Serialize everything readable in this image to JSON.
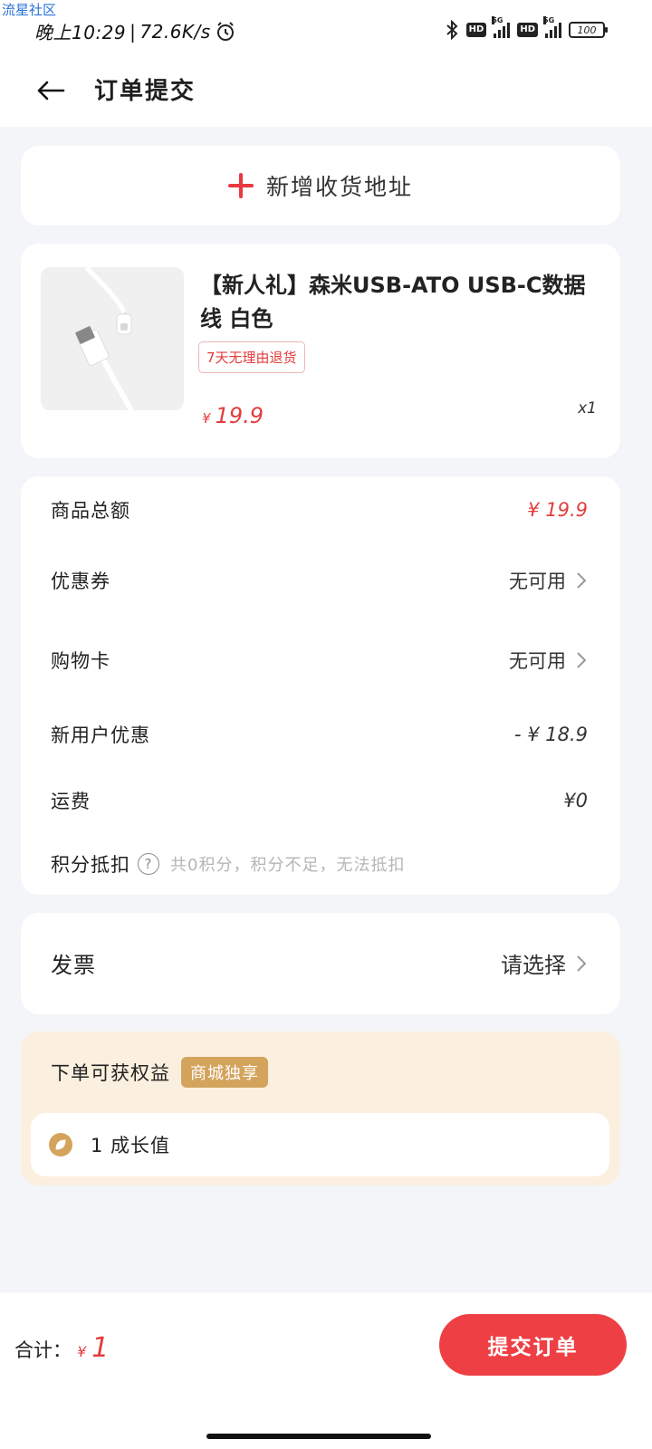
{
  "watermark": "流星社区",
  "status_bar": {
    "time": "晚上10:29",
    "speed": "72.6K/s",
    "battery": "100",
    "network_badge": "HD",
    "network_type": "5G",
    "icons": [
      "alarm-icon",
      "bluetooth-icon",
      "signal-icon",
      "battery-icon"
    ]
  },
  "header": {
    "title": "订单提交",
    "back_icon": "arrow-left-icon"
  },
  "address": {
    "label": "新增收货地址",
    "icon": "plus-icon",
    "accent": "#e83a3f"
  },
  "product": {
    "title": "【新人礼】森米USB-ATO USB-C数据线 白色",
    "tag": "7天无理由退货",
    "price_symbol": "¥",
    "price": "19.9",
    "quantity": "x1"
  },
  "summary": {
    "rows": [
      {
        "label": "商品总额",
        "value": "¥ 19.9"
      },
      {
        "label": "优惠券",
        "value": "无可用"
      },
      {
        "label": "购物卡",
        "value": "无可用"
      },
      {
        "label": "新用户优惠",
        "value": "- ¥ 18.9"
      },
      {
        "label": "运费",
        "value": "¥0"
      },
      {
        "label": "积分抵扣",
        "value": "共0积分，积分不足，无法抵扣"
      }
    ]
  },
  "invoice": {
    "label": "发票",
    "value": "请选择"
  },
  "benefits": {
    "title": "下单可获权益",
    "badge": "商城独享",
    "item": "1 成长值",
    "accent": "#d4a35c"
  },
  "footer": {
    "total_label": "合计：",
    "total_symbol": "¥",
    "total_value": "1",
    "submit_label": "提交订单",
    "submit_color": "#ee3f44"
  }
}
